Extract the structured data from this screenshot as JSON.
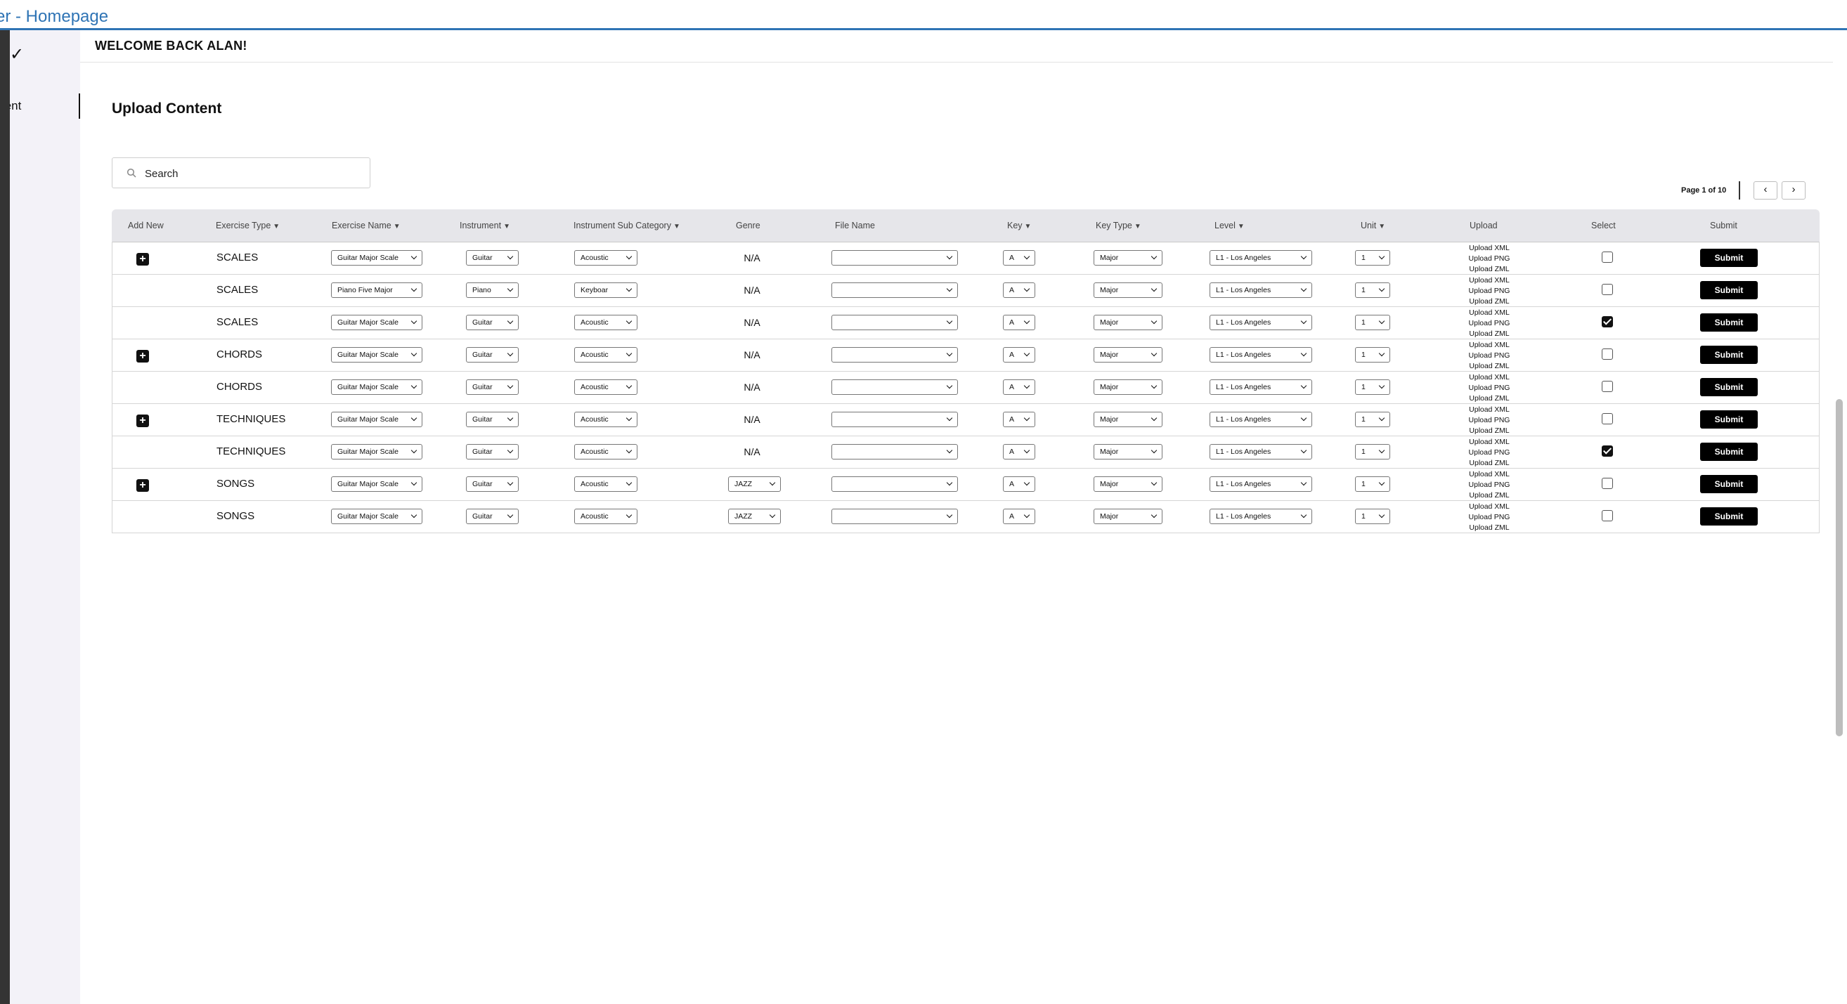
{
  "window": {
    "title": "er - Homepage"
  },
  "sidebar": {
    "active_item": "tent"
  },
  "header": {
    "welcome": "WELCOME BACK ALAN!"
  },
  "section": {
    "title": "Upload Content"
  },
  "search": {
    "placeholder": "Search",
    "value": ""
  },
  "pager": {
    "label": "Page 1 of 10",
    "prev": "‹",
    "next": "›"
  },
  "table": {
    "columns": {
      "add_new": "Add New",
      "exercise_type": "Exercise Type",
      "exercise_name": "Exercise Name",
      "instrument": "Instrument",
      "instrument_sub_category": "Instrument Sub Category",
      "genre": "Genre",
      "file_name": "File Name",
      "key": "Key",
      "key_type": "Key Type",
      "level": "Level",
      "unit": "Unit",
      "upload": "Upload",
      "select": "Select",
      "submit": "Submit"
    },
    "sort_arrow": "▼",
    "add_symbol": "+",
    "upload_links": [
      "Upload XML",
      "Upload PNG",
      "Upload ZML"
    ],
    "submit_label": "Submit",
    "rows": [
      {
        "add": true,
        "type": "SCALES",
        "name": "Guitar Major Scale",
        "instrument": "Guitar",
        "sub": "Acoustic",
        "genre": "N/A",
        "file": "",
        "key": "A",
        "key_type": "Major",
        "level": "L1 - Los Angeles",
        "unit": "1",
        "selected": false
      },
      {
        "add": false,
        "type": "SCALES",
        "name": "Piano Five Major",
        "instrument": "Piano",
        "sub": "Keyboar",
        "genre": "N/A",
        "file": "",
        "key": "A",
        "key_type": "Major",
        "level": "L1 - Los Angeles",
        "unit": "1",
        "selected": false
      },
      {
        "add": false,
        "type": "SCALES",
        "name": "Guitar Major Scale",
        "instrument": "Guitar",
        "sub": "Acoustic",
        "genre": "N/A",
        "file": "",
        "key": "A",
        "key_type": "Major",
        "level": "L1 - Los Angeles",
        "unit": "1",
        "selected": true
      },
      {
        "add": true,
        "type": "CHORDS",
        "name": "Guitar Major Scale",
        "instrument": "Guitar",
        "sub": "Acoustic",
        "genre": "N/A",
        "file": "",
        "key": "A",
        "key_type": "Major",
        "level": "L1 - Los Angeles",
        "unit": "1",
        "selected": false
      },
      {
        "add": false,
        "type": "CHORDS",
        "name": "Guitar Major Scale",
        "instrument": "Guitar",
        "sub": "Acoustic",
        "genre": "N/A",
        "file": "",
        "key": "A",
        "key_type": "Major",
        "level": "L1 - Los Angeles",
        "unit": "1",
        "selected": false
      },
      {
        "add": true,
        "type": "TECHNIQUES",
        "name": "Guitar Major Scale",
        "instrument": "Guitar",
        "sub": "Acoustic",
        "genre": "N/A",
        "file": "",
        "key": "A",
        "key_type": "Major",
        "level": "L1 - Los Angeles",
        "unit": "1",
        "selected": false
      },
      {
        "add": false,
        "type": "TECHNIQUES",
        "name": "Guitar Major Scale",
        "instrument": "Guitar",
        "sub": "Acoustic",
        "genre": "N/A",
        "file": "",
        "key": "A",
        "key_type": "Major",
        "level": "L1 - Los Angeles",
        "unit": "1",
        "selected": true
      },
      {
        "add": true,
        "type": "SONGS",
        "name": "Guitar Major Scale",
        "instrument": "Guitar",
        "sub": "Acoustic",
        "genre": "JAZZ",
        "file": "",
        "key": "A",
        "key_type": "Major",
        "level": "L1 - Los Angeles",
        "unit": "1",
        "selected": false
      },
      {
        "add": false,
        "type": "SONGS",
        "name": "Guitar Major Scale",
        "instrument": "Guitar",
        "sub": "Acoustic",
        "genre": "JAZZ",
        "file": "",
        "key": "A",
        "key_type": "Major",
        "level": "L1 - Los Angeles",
        "unit": "1",
        "selected": false
      }
    ]
  }
}
